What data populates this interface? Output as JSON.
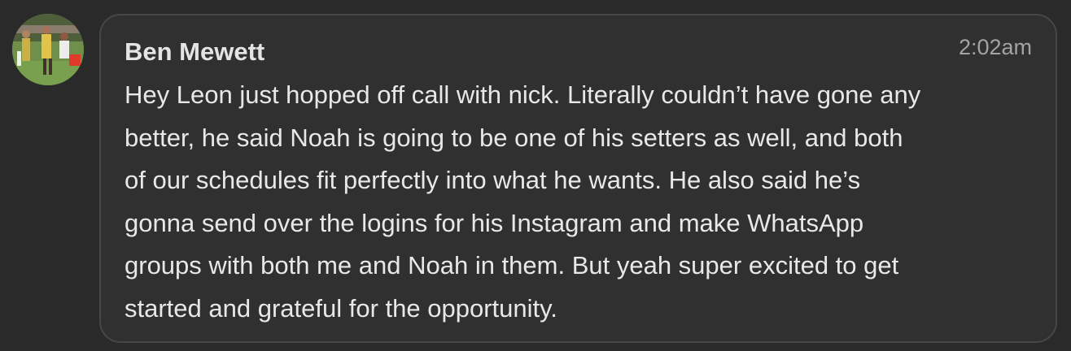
{
  "message": {
    "sender_name": "Ben Mewett",
    "timestamp": "2:02am",
    "avatar_icon": "user-photo-avatar",
    "lines": [
      "Hey Leon just hopped off call with nick. Literally couldn’t have gone any",
      "better, he said Noah is going to be one of his setters as well, and both",
      "of our schedules fit perfectly into what he wants. He also said he’s",
      "gonna send over the logins for his Instagram and make WhatsApp",
      "groups with both me and Noah in them. But yeah super excited to get",
      "started and grateful for the opportunity."
    ]
  },
  "colors": {
    "background": "#2a2a2a",
    "bubble": "#303030",
    "bubble_border": "#474747",
    "text": "#e8e8e8",
    "timestamp": "#a3a3a3"
  }
}
